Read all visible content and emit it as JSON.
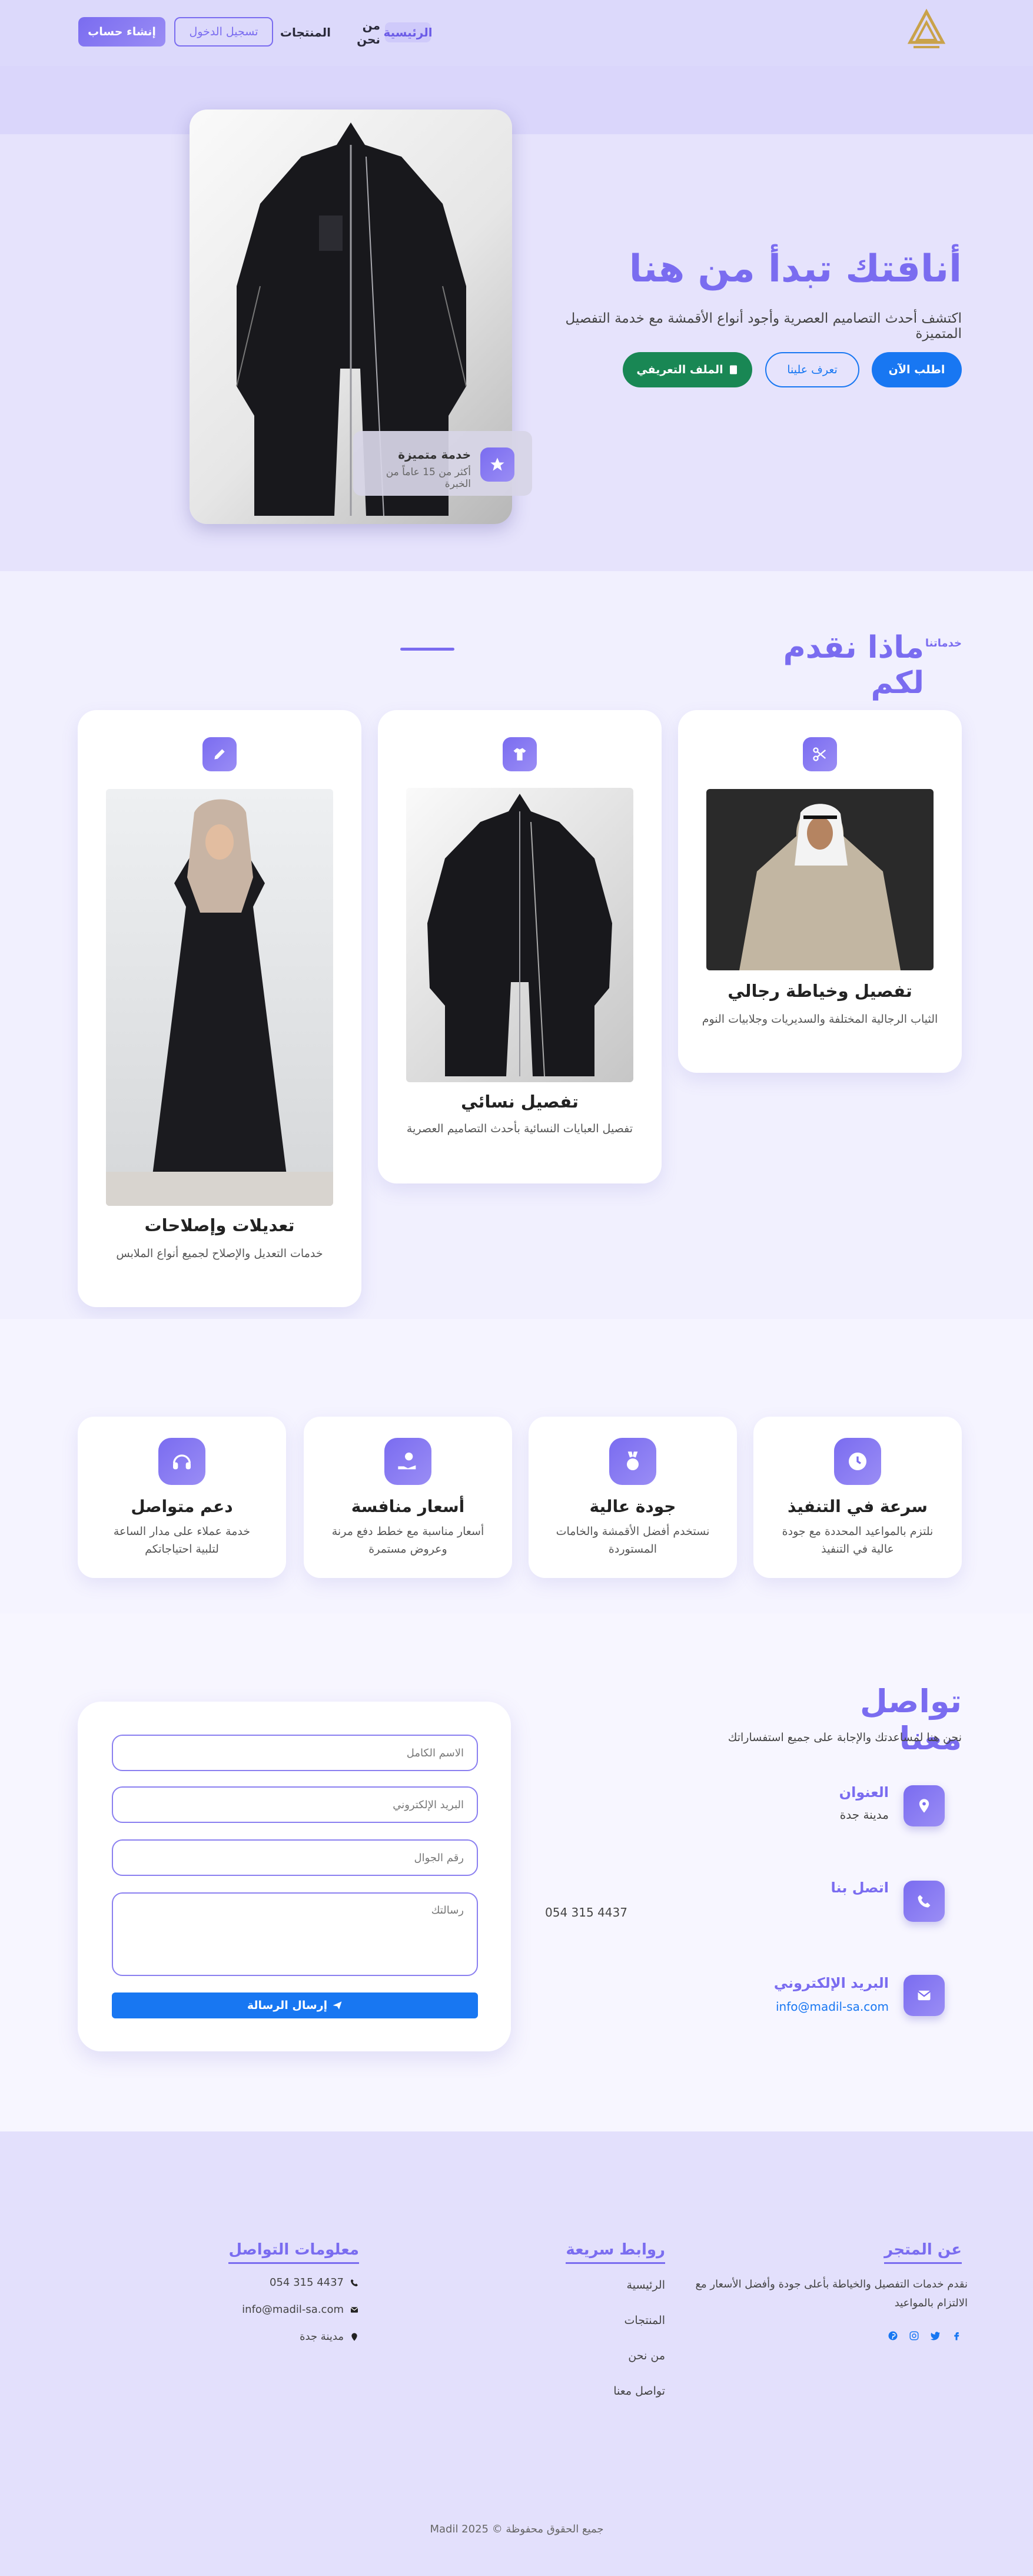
{
  "nav": {
    "links": {
      "home": "الرئيسية",
      "about": "من نحن",
      "products": "المنتجات"
    },
    "login": "تسجيل الدخول",
    "signup": "إنشاء حساب"
  },
  "hero": {
    "title": "أناقتك تبدأ من هنا",
    "subtitle": "اكتشف أحدث التصاميم العصرية وأجود أنواع الأقمشة مع خدمة التفصيل المتميزة",
    "buttons": {
      "order": "اطلب الآن",
      "know": "تعرف علينا",
      "profile": "الملف التعريفي"
    },
    "badge": {
      "title": "خدمة متميزة",
      "subtitle": "أكثر من 15 عاماً من الخبرة"
    }
  },
  "services": {
    "eyebrow": "خدماتنا",
    "title": "ماذا نقدم لكم",
    "cards": [
      {
        "title": "تفصيل وخياطة رجالي",
        "desc": "الثياب الرجالية المختلفة والسديريات وجلابيات النوم",
        "icon": "scissors-icon"
      },
      {
        "title": "تفصيل نسائي",
        "desc": "تفصيل العبايات النسائية بأحدث التصاميم العصرية",
        "icon": "shirt-icon"
      },
      {
        "title": "تعديلات وإصلاحات",
        "desc": "خدمات التعديل والإصلاح لجميع أنواع الملابس",
        "icon": "pencil-icon"
      }
    ]
  },
  "features": [
    {
      "title": "سرعة في التنفيذ",
      "desc": "نلتزم بالمواعيد المحددة مع جودة عالية في التنفيذ",
      "icon": "clock-icon"
    },
    {
      "title": "جودة عالية",
      "desc": "نستخدم أفضل الأقمشة والخامات المستوردة",
      "icon": "medal-icon"
    },
    {
      "title": "أسعار منافسة",
      "desc": "أسعار مناسبة مع خطط دفع مرنة وعروض مستمرة",
      "icon": "hand-coin-icon"
    },
    {
      "title": "دعم متواصل",
      "desc": "خدمة عملاء على مدار الساعة لتلبية احتياجاتكم",
      "icon": "headset-icon"
    }
  ],
  "contact": {
    "title": "تواصل معنا",
    "subtitle": "نحن هنا لمساعدتك والإجابة على جميع استفساراتك",
    "address": {
      "label": "العنوان",
      "value": "مدينة جدة"
    },
    "phone": {
      "label": "اتصل بنا",
      "value": "054 315 4437"
    },
    "email": {
      "label": "البريد الإلكتروني",
      "value": "info@madil-sa.com"
    },
    "form": {
      "name_placeholder": "الاسم الكامل",
      "email_placeholder": "البريد الإلكتروني",
      "phone_placeholder": "رقم الجوال",
      "message_placeholder": "رسالتك",
      "send": "إرسال الرسالة"
    }
  },
  "footer": {
    "about": {
      "title": "عن المتجر",
      "text": "نقدم خدمات التفصيل والخياطة بأعلى جودة وأفضل الأسعار مع الالتزام بالمواعيد"
    },
    "links": {
      "title": "روابط سريعة",
      "items": [
        "الرئيسية",
        "المنتجات",
        "من نحن",
        "تواصل معنا"
      ]
    },
    "contact": {
      "title": "معلومات التواصل",
      "phone": "054 315 4437",
      "email": "info@madil-sa.com",
      "address": "مدينة جدة"
    },
    "copyright": "جميع الحقوق محفوظة © Madil 2025"
  },
  "colors": {
    "primary": "#7a6cf0",
    "blue": "#1877f2",
    "green": "#198754",
    "background": "#f4f3fe"
  }
}
